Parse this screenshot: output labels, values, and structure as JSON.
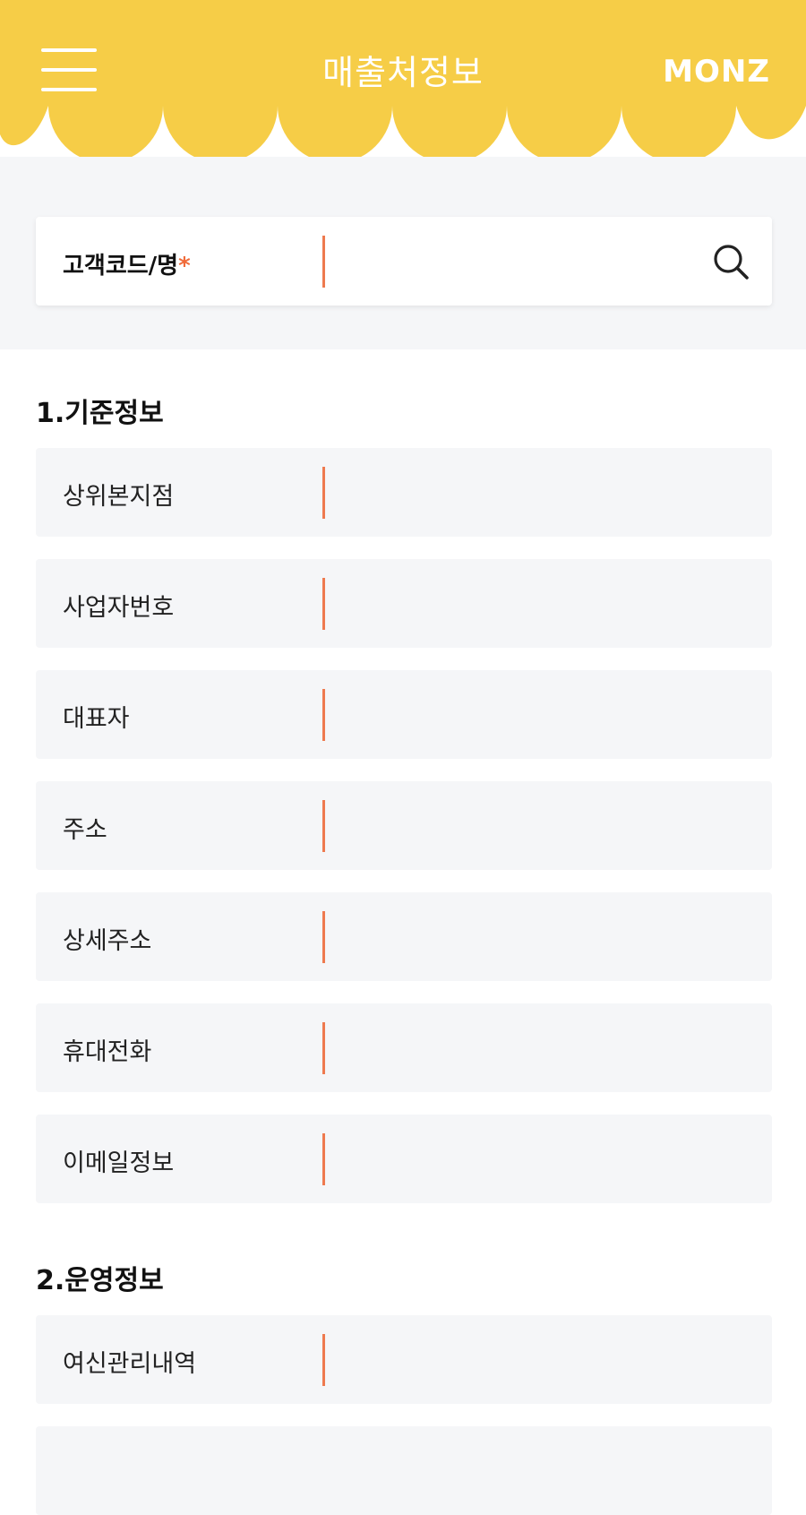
{
  "header": {
    "title": "매출처정보",
    "logo": "MONZ",
    "bg_color": "#f6cd47"
  },
  "search": {
    "label": "고객코드/명",
    "required_mark": "*",
    "value": ""
  },
  "sections": [
    {
      "title": "1.기준정보",
      "fields": [
        "상위본지점",
        "사업자번호",
        "대표자",
        "주소",
        "상세주소",
        "휴대전화",
        "이메일정보"
      ]
    },
    {
      "title": "2.운영정보",
      "fields": [
        "여신관리내역"
      ]
    }
  ],
  "colors": {
    "accent": "#f06b3a",
    "caret": "#ee7a4f",
    "field_bg": "#f5f6f8"
  }
}
